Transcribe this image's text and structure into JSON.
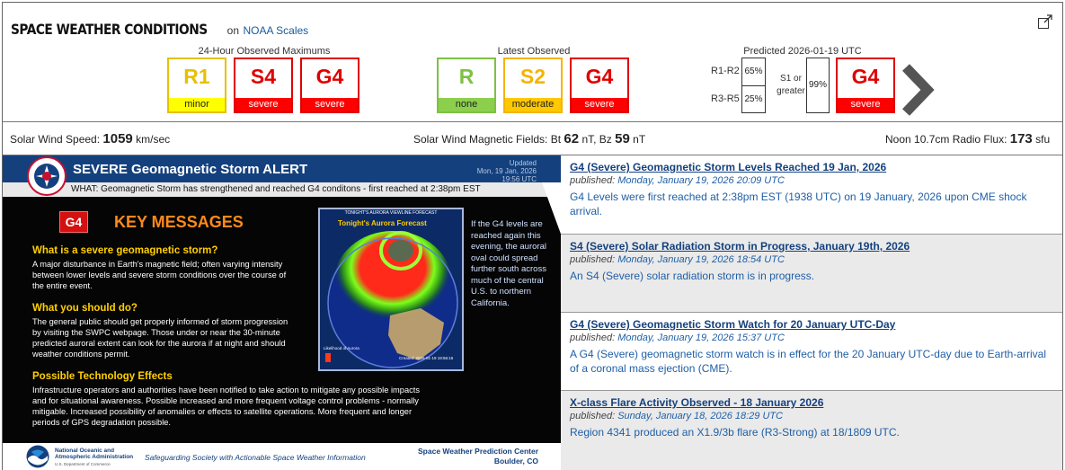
{
  "header": {
    "title": "SPACE WEATHER CONDITIONS",
    "on_text": "on",
    "scales_link": "NOAA Scales",
    "observed_max_label": "24-Hour Observed Maximums",
    "latest_label": "Latest Observed",
    "predicted_label": "Predicted 2026-01-19 UTC"
  },
  "observed_max": [
    {
      "code": "R1",
      "level": "minor",
      "fg": "#e6c100",
      "bg": "#ffff00"
    },
    {
      "code": "S4",
      "level": "severe",
      "fg": "#e00000",
      "bg": "#ff0000"
    },
    {
      "code": "G4",
      "level": "severe",
      "fg": "#e00000",
      "bg": "#ff0000"
    }
  ],
  "latest": [
    {
      "code": "R",
      "level": "none",
      "fg": "#7dc142",
      "bg": "#8ccf4d"
    },
    {
      "code": "S2",
      "level": "moderate",
      "fg": "#f5b400",
      "bg": "#ffc800"
    },
    {
      "code": "G4",
      "level": "severe",
      "fg": "#e00000",
      "bg": "#ff0000"
    }
  ],
  "predicted": {
    "r1_r2_label": "R1-R2",
    "r1_r2_prob": "65%",
    "r3_r5_label": "R3-R5",
    "r3_r5_prob": "25%",
    "s1_label_a": "S1 or",
    "s1_label_b": "greater",
    "s1_prob": "99%",
    "g": {
      "code": "G4",
      "level": "severe",
      "fg": "#e00000",
      "bg": "#ff0000"
    }
  },
  "solar_wind": {
    "speed_label": "Solar Wind Speed:",
    "speed_value": "1059",
    "speed_unit": "km/sec",
    "mag_label": "Solar Wind Magnetic Fields: Bt",
    "bt_value": "62",
    "bz_label": "nT, Bz",
    "bz_value": "59",
    "bz_unit": "nT",
    "flux_label": "Noon 10.7cm Radio Flux:",
    "flux_value": "173",
    "flux_unit": "sfu"
  },
  "alert": {
    "logo_text": "NATIONAL WEATHER SERVICE",
    "title": "SEVERE Geomagnetic Storm ALERT",
    "updated_a": "Updated",
    "updated_b": "Mon, 19 Jan, 2026",
    "updated_c": "19:56 UTC",
    "what": "WHAT: Geomagnetic Storm has strengthened and reached G4 conditons - first reached at 2:38pm EST",
    "g_badge": "G4",
    "key_messages": "KEY MESSAGES",
    "q1": "What is a severe geomagnetic storm?",
    "t1": "A major disturbance in Earth's magnetic field; often varying intensity between lower levels and severe storm conditions over the course of the entire event.",
    "q2": "What you should do?",
    "t2": "The general public should get properly informed of storm progression by visiting the SWPC webpage. Those under or near the 30-minute predicted auroral extent can look for the aurora if at night and should weather conditions permit.",
    "q3": "Possible Technology Effects",
    "t3": "Infrastructure operators and authorities have been notified to take action to mitigate any possible impacts and for situational awareness. Possible increased and more frequent voltage control problems - normally mitigable. Increased possibility of anomalies or effects to satellite operations. More frequent and longer periods of GPS degradation possible.",
    "map_title": "TONIGHT'S AURORA VIEWLINE FORECAST",
    "map_sub": "Tonight's Aurora Forecast",
    "map_legend": "Likelihood of Aurora",
    "map_created": "Created: 2026-01-19 19:56:16",
    "side_text": "If the G4 levels are reached again this evening, the auroral oval could spread further south across much of the central U.S. to northern California.",
    "noaa_name_a": "National Oceanic and",
    "noaa_name_b": "Atmospheric Administration",
    "noaa_dept": "U.S. Department of Commerce",
    "motto": "Safeguarding Society with Actionable Space Weather Information",
    "swpc_a": "Space Weather Prediction Center",
    "swpc_b": "Boulder, CO"
  },
  "news": [
    {
      "title": "G4 (Severe) Geomagnetic Storm Levels Reached 19 Jan, 2026",
      "published": "published:",
      "date": "Monday, January 19, 2026 20:09 UTC",
      "body": "G4 Levels were first reached at 2:38pm EST (1938 UTC) on 19 January, 2026 upon CME shock arrival."
    },
    {
      "title": "S4 (Severe) Solar Radiation Storm in Progress, January 19th, 2026",
      "published": "published:",
      "date": "Monday, January 19, 2026 18:54 UTC",
      "body": "An S4 (Severe) solar radiation storm is in progress."
    },
    {
      "title": "G4 (Severe) Geomagnetic Storm Watch for 20 January UTC-Day",
      "published": "published:",
      "date": "Monday, January 19, 2026 15:37 UTC",
      "body": "A G4 (Severe) geomagnetic storm watch is in effect for the 20 January UTC-day due to Earth-arrival of a coronal mass ejection (CME)."
    },
    {
      "title": "X-class Flare Activity Observed - 18 January 2026",
      "published": "published:",
      "date": "Sunday, January 18, 2026 18:29 UTC",
      "body": "Region 4341 produced an X1.9/3b flare (R3-Strong) at 18/1809 UTC."
    }
  ]
}
